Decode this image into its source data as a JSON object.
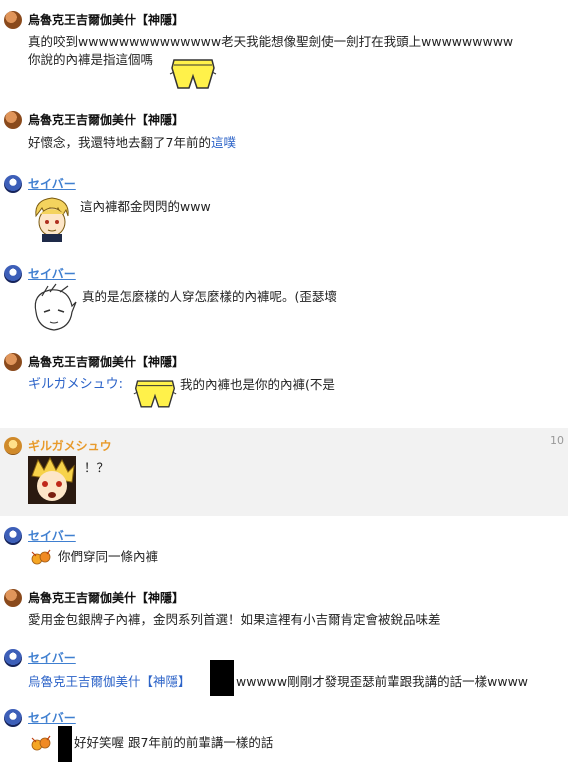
{
  "messages": [
    {
      "user": "烏魯克王吉爾伽美什【神隱】",
      "lines": [
        "真的咬到wwwwwwwwwwwwww老天我能想像聖劍使一劍打在我頭上wwwwwwwww",
        "你說的內褲是指這個嗎"
      ]
    },
    {
      "user": "烏魯克王吉爾伽美什【神隱】",
      "prefix": "好懷念，我還特地去翻了7年前的",
      "link": "這噗"
    },
    {
      "user": "セイバー",
      "text": "這內褲都金閃閃的www"
    },
    {
      "user": "セイバー",
      "text": "真的是怎麼樣的人穿怎麼樣的內褲呢。(歪瑟壞"
    },
    {
      "user": "烏魯克王吉爾伽美什【神隱】",
      "mention": "ギルガメシュウ:",
      "text": "我的內褲也是你的內褲(不是"
    },
    {
      "user": "ギルガメシュウ",
      "timestamp": "10",
      "text": "！？"
    },
    {
      "user": "セイバー",
      "text": "你們穿同一條內褲"
    },
    {
      "user": "烏魯克王吉爾伽美什【神隱】",
      "text": "愛用金包銀牌子內褲，金閃系列首選！如果這裡有小吉爾肯定會被銳品味差"
    },
    {
      "user": "セイバー",
      "mention": "烏魯克王吉爾伽美什【神隱】",
      "text": "wwwww剛剛才發現歪瑟前輩跟我講的話一樣wwww"
    },
    {
      "user": "セイバー",
      "text": "好好笑喔 跟7年前的前輩講一樣的話"
    }
  ],
  "icons": {
    "avatar_gilgamesh": "avatar-gilgamesh-icon",
    "avatar_saber": "avatar-saber-icon",
    "avatar_gilgamesh_user": "avatar-gilgamesh-user-icon"
  },
  "colors": {
    "username_saber": "#3f7fd0",
    "username_gilgamesh_user": "#e89a2a",
    "link": "#2c63c8",
    "highlight_row": "#f2f2f2"
  }
}
